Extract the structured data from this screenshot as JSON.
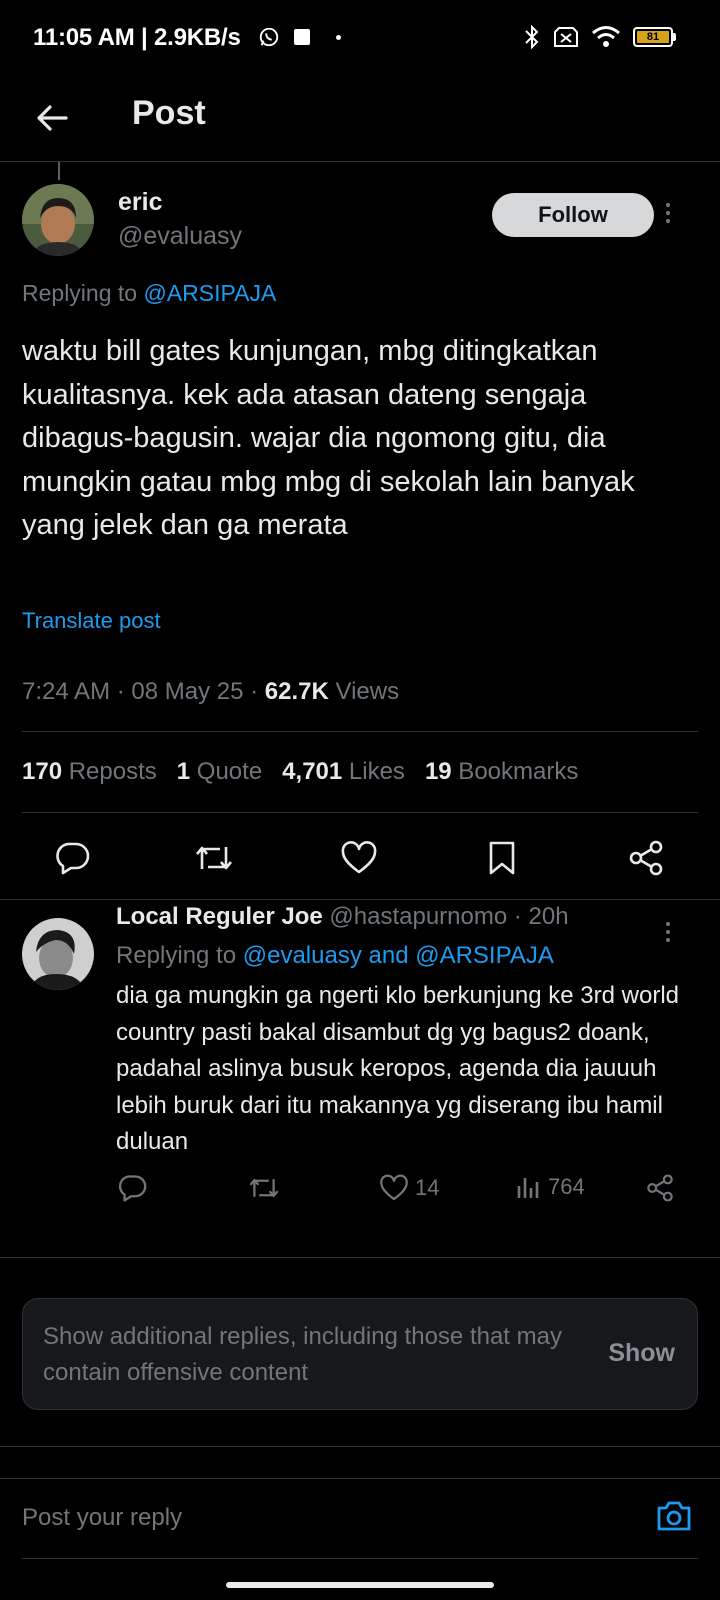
{
  "status_bar": {
    "time": "11:05 AM | 2.9KB/s",
    "battery": "81",
    "icons": [
      "whatsapp-icon",
      "square-icon",
      "dot-icon",
      "bluetooth-icon",
      "sim-off-icon",
      "wifi-icon",
      "battery-icon"
    ]
  },
  "header": {
    "title": "Post",
    "back_icon": "arrow-left-icon"
  },
  "tweet": {
    "author_name": "eric",
    "author_handle": "@evaluasy",
    "follow_label": "Follow",
    "replying_prefix": "Replying to",
    "replying_to": "@ARSIPAJA",
    "text": "waktu bill gates kunjungan, mbg ditingkatkan kualitasnya. kek ada atasan dateng sengaja dibagus-bagusin. wajar dia ngomong gitu, dia mungkin gatau mbg mbg di sekolah lain banyak yang jelek dan ga merata",
    "translate": "Translate post",
    "time": "7:24 AM · 08 May 25 · ",
    "views_count": "62.7K",
    "views_label": " Views",
    "stats": {
      "reposts_count": "170",
      "reposts_label": " Reposts",
      "quotes_count": "1",
      "quotes_label": " Quote",
      "likes_count": "4,701",
      "likes_label": " Likes",
      "bookmarks_count": "19",
      "bookmarks_label": " Bookmarks"
    },
    "actions": [
      "reply-icon",
      "repost-icon",
      "like-icon",
      "bookmark-icon",
      "share-icon"
    ]
  },
  "reply": {
    "author_name": "Local Reguler Joe",
    "author_meta": " @hastapurnomo · 20h",
    "replying_prefix": "Replying to ",
    "replying_to": "@evaluasy and @ARSIPAJA",
    "text": "dia ga mungkin ga ngerti klo berkunjung ke 3rd world country pasti bakal disambut dg yg bagus2 doank, padahal aslinya busuk keropos, agenda dia jauuuh lebih buruk dari itu makannya yg diserang ibu hamil duluan",
    "likes": "14",
    "views": "764"
  },
  "more_replies": {
    "text": "Show additional replies, including those that may contain offensive content",
    "button": "Show"
  },
  "compose": {
    "placeholder": "Post your reply"
  },
  "colors": {
    "accent": "#1d9bf0",
    "muted": "#71767b",
    "text": "#e7e9ea",
    "background": "#000000",
    "divider": "#2f3336"
  }
}
